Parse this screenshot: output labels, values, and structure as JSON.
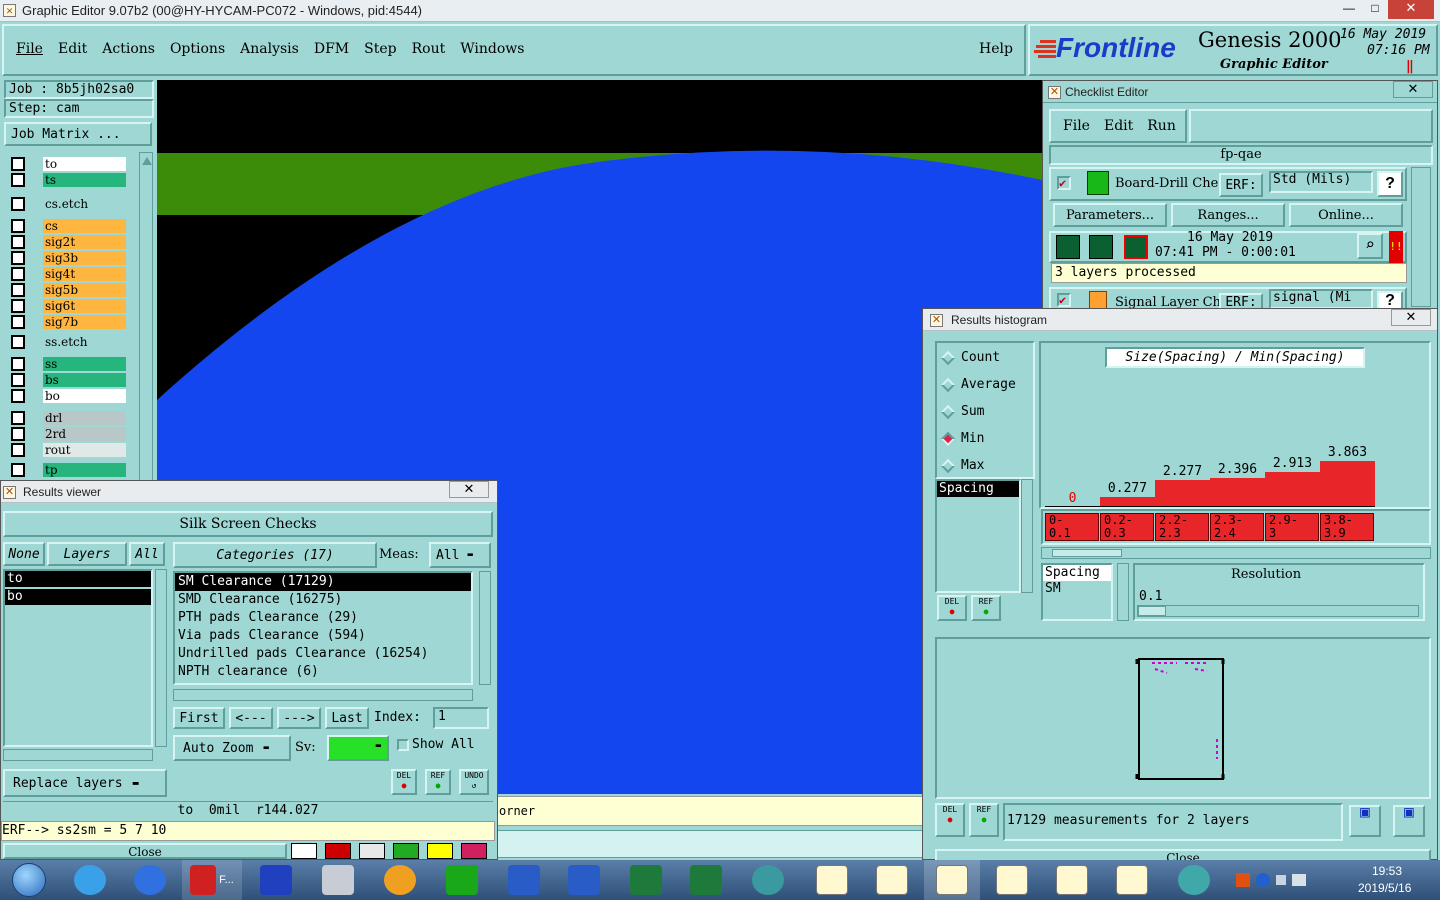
{
  "window": {
    "title": "Graphic Editor 9.07b2 (00@HY-HYCAM-PC072 - Windows, pid:4544)",
    "controls": [
      "—",
      "□",
      "✕"
    ]
  },
  "menubar": {
    "items": [
      "File",
      "Edit",
      "Actions",
      "Options",
      "Analysis",
      "DFM",
      "Step",
      "Rout",
      "Windows"
    ],
    "help": "Help"
  },
  "brand": {
    "logo": "Frontline",
    "product": "Genesis 2000",
    "subtitle": "Graphic Editor",
    "date": "16 May 2019",
    "time": "07:16 PM",
    "pause": "‖"
  },
  "job": {
    "job_label": "Job  : 8b5jh02sa0",
    "step_label": "Step: cam",
    "matrix_button": "Job Matrix ..."
  },
  "layers": [
    {
      "name": "to",
      "color": "#ffffff"
    },
    {
      "name": "ts",
      "color": "#26b57d"
    },
    {
      "name": "cs.etch",
      "color": "#9ed7d3"
    },
    {
      "name": "cs",
      "color": "#ffb640"
    },
    {
      "name": "sig2t",
      "color": "#ffb640"
    },
    {
      "name": "sig3b",
      "color": "#ffb640"
    },
    {
      "name": "sig4t",
      "color": "#ffb640"
    },
    {
      "name": "sig5b",
      "color": "#ffb640"
    },
    {
      "name": "sig6t",
      "color": "#ffb640"
    },
    {
      "name": "sig7b",
      "color": "#ffb640"
    },
    {
      "name": "ss.etch",
      "color": "#9ed7d3"
    },
    {
      "name": "ss",
      "color": "#26b57d"
    },
    {
      "name": "bs",
      "color": "#26b57d"
    },
    {
      "name": "bo",
      "color": "#ffffff"
    },
    {
      "name": "drl",
      "color": "#b8c8c8"
    },
    {
      "name": "2rd",
      "color": "#b8c8c8"
    },
    {
      "name": "rout",
      "color": "#e0e8e8"
    },
    {
      "name": "tp",
      "color": "#26b57d"
    }
  ],
  "results_viewer": {
    "title": "Results viewer",
    "header": "Silk Screen Checks",
    "none": "None",
    "layers": "Layers",
    "all": "All",
    "categories_label": "Categories (17)",
    "meas_label": "Meas:",
    "meas_value": "All",
    "layer_list": [
      "to",
      "bo"
    ],
    "categories": [
      "SM Clearance (17129)",
      "SMD Clearance (16275)",
      "PTH pads Clearance (29)",
      "Via pads Clearance (594)",
      "Undrilled pads Clearance (16254)",
      "NPTH clearance (6)"
    ],
    "first": "First",
    "prev": "<---",
    "next": "--->",
    "last": "Last",
    "index_label": "Index:",
    "index_value": "1",
    "auto_zoom": "Auto Zoom",
    "sv_label": "Sv:",
    "show_all": "Show All",
    "replace_layers": "Replace layers",
    "status": "to  0mil  r144.027",
    "erf": "ERF--> ss2sm = 5 7 10",
    "close": "Close",
    "del": "DEL",
    "ref": "REF",
    "undo": "UNDO"
  },
  "canvas_status": {
    "text": "orner"
  },
  "checklist": {
    "title": "Checklist Editor",
    "menu": [
      "File",
      "Edit",
      "Run"
    ],
    "name": "fp-qae",
    "item1": "Board-Drill Che",
    "erf": "ERF:",
    "item1_erf": "Std (Mils)",
    "params": "Parameters...",
    "ranges": "Ranges...",
    "online": "Online...",
    "date_line1": "16 May 2019",
    "date_line2": "07:41 PM - 0:00:01",
    "processed": "3 layers processed",
    "item2": "Signal Layer Ch",
    "item2_erf": "signal (Mi",
    "help": "?"
  },
  "histogram": {
    "title": "Results histogram",
    "modes": [
      {
        "label": "Count",
        "on": false
      },
      {
        "label": "Average",
        "on": false
      },
      {
        "label": "Sum",
        "on": false
      },
      {
        "label": "Min",
        "on": true
      },
      {
        "label": "Max",
        "on": false
      }
    ],
    "measure_list": [
      "Spacing"
    ],
    "chart_title": "Size(Spacing) / Min(Spacing)",
    "bar_labels": [
      "0",
      "0.277",
      "2.277",
      "2.396",
      "2.913",
      "3.863"
    ],
    "bins": [
      "0-\n0.1",
      "0.2-\n0.3",
      "2.2-\n2.3",
      "2.3-\n2.4",
      "2.9-\n3",
      "3.8-\n3.9"
    ],
    "measure_box": [
      "Spacing",
      "SM"
    ],
    "resolution_label": "Resolution",
    "resolution_value": "0.1",
    "summary": "17129 measurements for 2 layers",
    "close": "Close",
    "del": "DEL",
    "ref": "REF"
  },
  "chart_data": {
    "type": "bar",
    "title": "Size(Spacing) / Min(Spacing)",
    "categories": [
      "0-0.1",
      "0.2-0.3",
      "2.2-2.3",
      "2.3-2.4",
      "2.9-3",
      "3.8-3.9"
    ],
    "values": [
      0,
      0.277,
      2.277,
      2.396,
      2.913,
      3.863
    ],
    "ylim": [
      0,
      3.863
    ]
  },
  "taskbar": {
    "clock_time": "19:53",
    "clock_date": "2019/5/16",
    "app_label": "F..."
  }
}
